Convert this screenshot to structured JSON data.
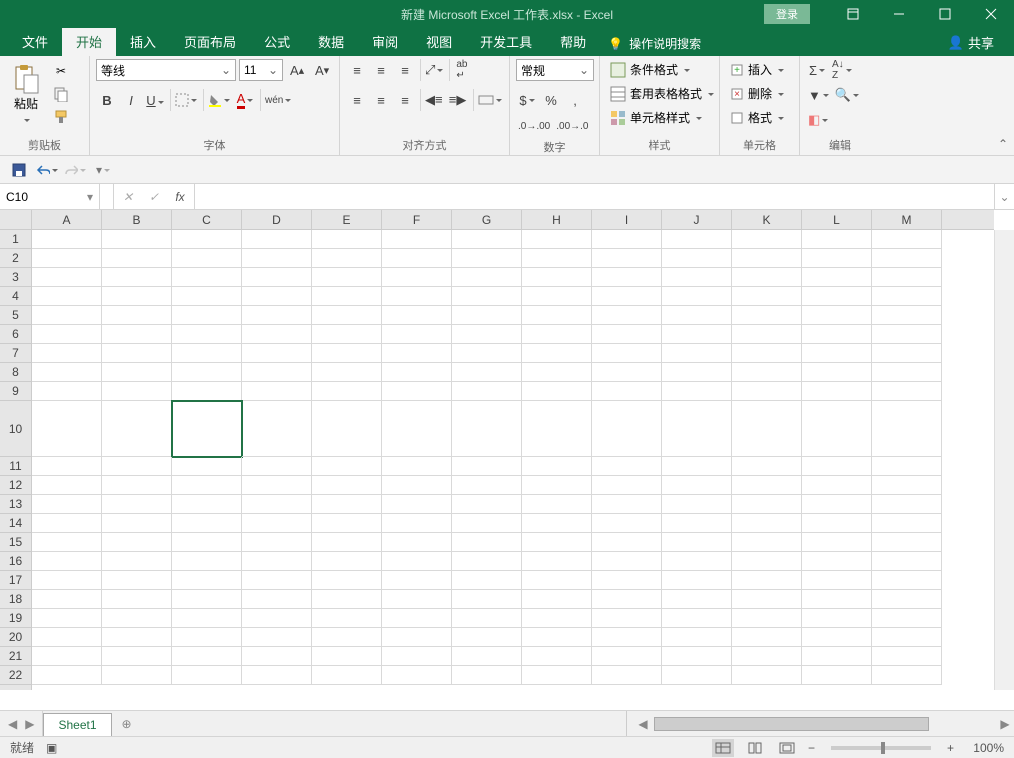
{
  "title": "新建 Microsoft Excel 工作表.xlsx  -  Excel",
  "login": "登录",
  "tabs": {
    "file": "文件",
    "home": "开始",
    "insert": "插入",
    "layout": "页面布局",
    "formulas": "公式",
    "data": "数据",
    "review": "审阅",
    "view": "视图",
    "dev": "开发工具",
    "help": "帮助"
  },
  "tell_me": "操作说明搜索",
  "share": "共享",
  "ribbon": {
    "clipboard": {
      "paste": "粘贴",
      "label": "剪贴板"
    },
    "font": {
      "name": "等线",
      "size": "11",
      "label": "字体"
    },
    "align": {
      "label": "对齐方式"
    },
    "number": {
      "format": "常规",
      "label": "数字"
    },
    "styles": {
      "cond": "条件格式",
      "table": "套用表格格式",
      "cell": "单元格样式",
      "label": "样式"
    },
    "cells": {
      "insert": "插入",
      "delete": "删除",
      "format": "格式",
      "label": "单元格"
    },
    "editing": {
      "label": "编辑"
    }
  },
  "name_box": "C10",
  "columns": [
    "A",
    "B",
    "C",
    "D",
    "E",
    "F",
    "G",
    "H",
    "I",
    "J",
    "K",
    "L",
    "M"
  ],
  "rows": [
    "1",
    "2",
    "3",
    "4",
    "5",
    "6",
    "7",
    "8",
    "9",
    "10",
    "11",
    "12",
    "13",
    "14",
    "15",
    "16",
    "17",
    "18",
    "19",
    "20",
    "21",
    "22"
  ],
  "tall_row_index": 9,
  "selected": {
    "col": 2,
    "row": 9
  },
  "sheet": "Sheet1",
  "status": "就绪",
  "zoom": "100%"
}
